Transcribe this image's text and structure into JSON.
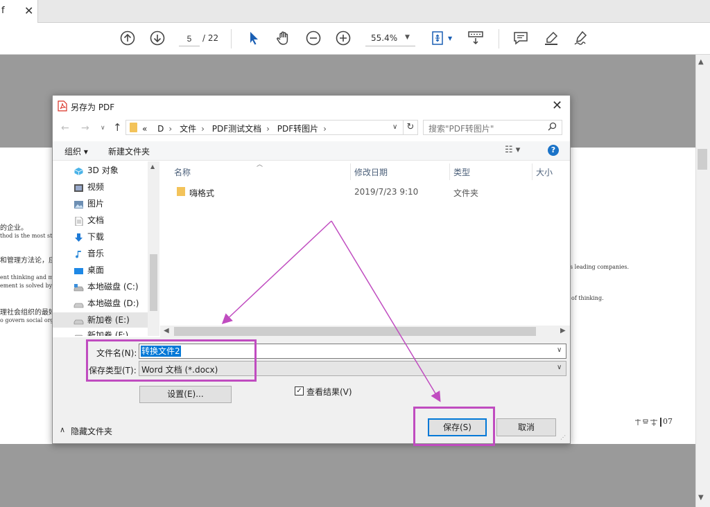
{
  "tab": {
    "title": "f",
    "close": "✕"
  },
  "toolbar": {
    "page_current": "5",
    "page_total": "/ 22",
    "zoom": "55.4%"
  },
  "pdf_page": {
    "lines": [
      {
        "text": "的企业。"
      },
      {
        "text": "thod is the most stand"
      },
      {
        "text": "和管理方法论，应"
      },
      {
        "text": "ent thinking and mana"
      },
      {
        "text": "ement is solved by lav"
      },
      {
        "text": "理社会组织的最好"
      },
      {
        "text": "o govern social organ"
      },
      {
        "text": "s leading companies."
      },
      {
        "text": "of thinking."
      }
    ],
    "footer_num": "07"
  },
  "dialog": {
    "title": "另存为 PDF",
    "breadcrumbs": [
      "«",
      "D",
      "文件",
      "PDF测试文档",
      "PDF转图片"
    ],
    "search_placeholder": "搜索\"PDF转图片\"",
    "organize": "组织 ▾",
    "new_folder": "新建文件夹",
    "nav_items": [
      {
        "label": "3D 对象",
        "icon": "cube-icon"
      },
      {
        "label": "视频",
        "icon": "video-icon"
      },
      {
        "label": "图片",
        "icon": "picture-icon"
      },
      {
        "label": "文档",
        "icon": "document-icon"
      },
      {
        "label": "下载",
        "icon": "download-icon"
      },
      {
        "label": "音乐",
        "icon": "music-icon"
      },
      {
        "label": "桌面",
        "icon": "desktop-icon"
      },
      {
        "label": "本地磁盘 (C:)",
        "icon": "drive-icon"
      },
      {
        "label": "本地磁盘 (D:)",
        "icon": "drive-icon"
      },
      {
        "label": "新加卷 (E:)",
        "icon": "drive-icon"
      },
      {
        "label": "新加卷 (F:)",
        "icon": "drive-icon"
      }
    ],
    "columns": [
      "名称",
      "修改日期",
      "类型",
      "大小"
    ],
    "files": [
      {
        "name": "嗨格式",
        "modified": "2019/7/23 9:10",
        "type": "文件夹",
        "size": ""
      }
    ],
    "filename_label": "文件名(N):",
    "filename_value": "转换文件2",
    "filetype_label": "保存类型(T):",
    "filetype_value": "Word 文档 (*.docx)",
    "settings_button": "设置(E)...",
    "view_result_label": "查看结果(V)",
    "view_result_checked": "✓",
    "hide_folders": "隐藏文件夹",
    "save_button": "保存(S)",
    "cancel_button": "取消"
  },
  "colors": {
    "annotation": "#c04cc0",
    "accent": "#0078d7",
    "toolbar_icon": "#333333",
    "cursor_tool": "#1a5fb4"
  }
}
